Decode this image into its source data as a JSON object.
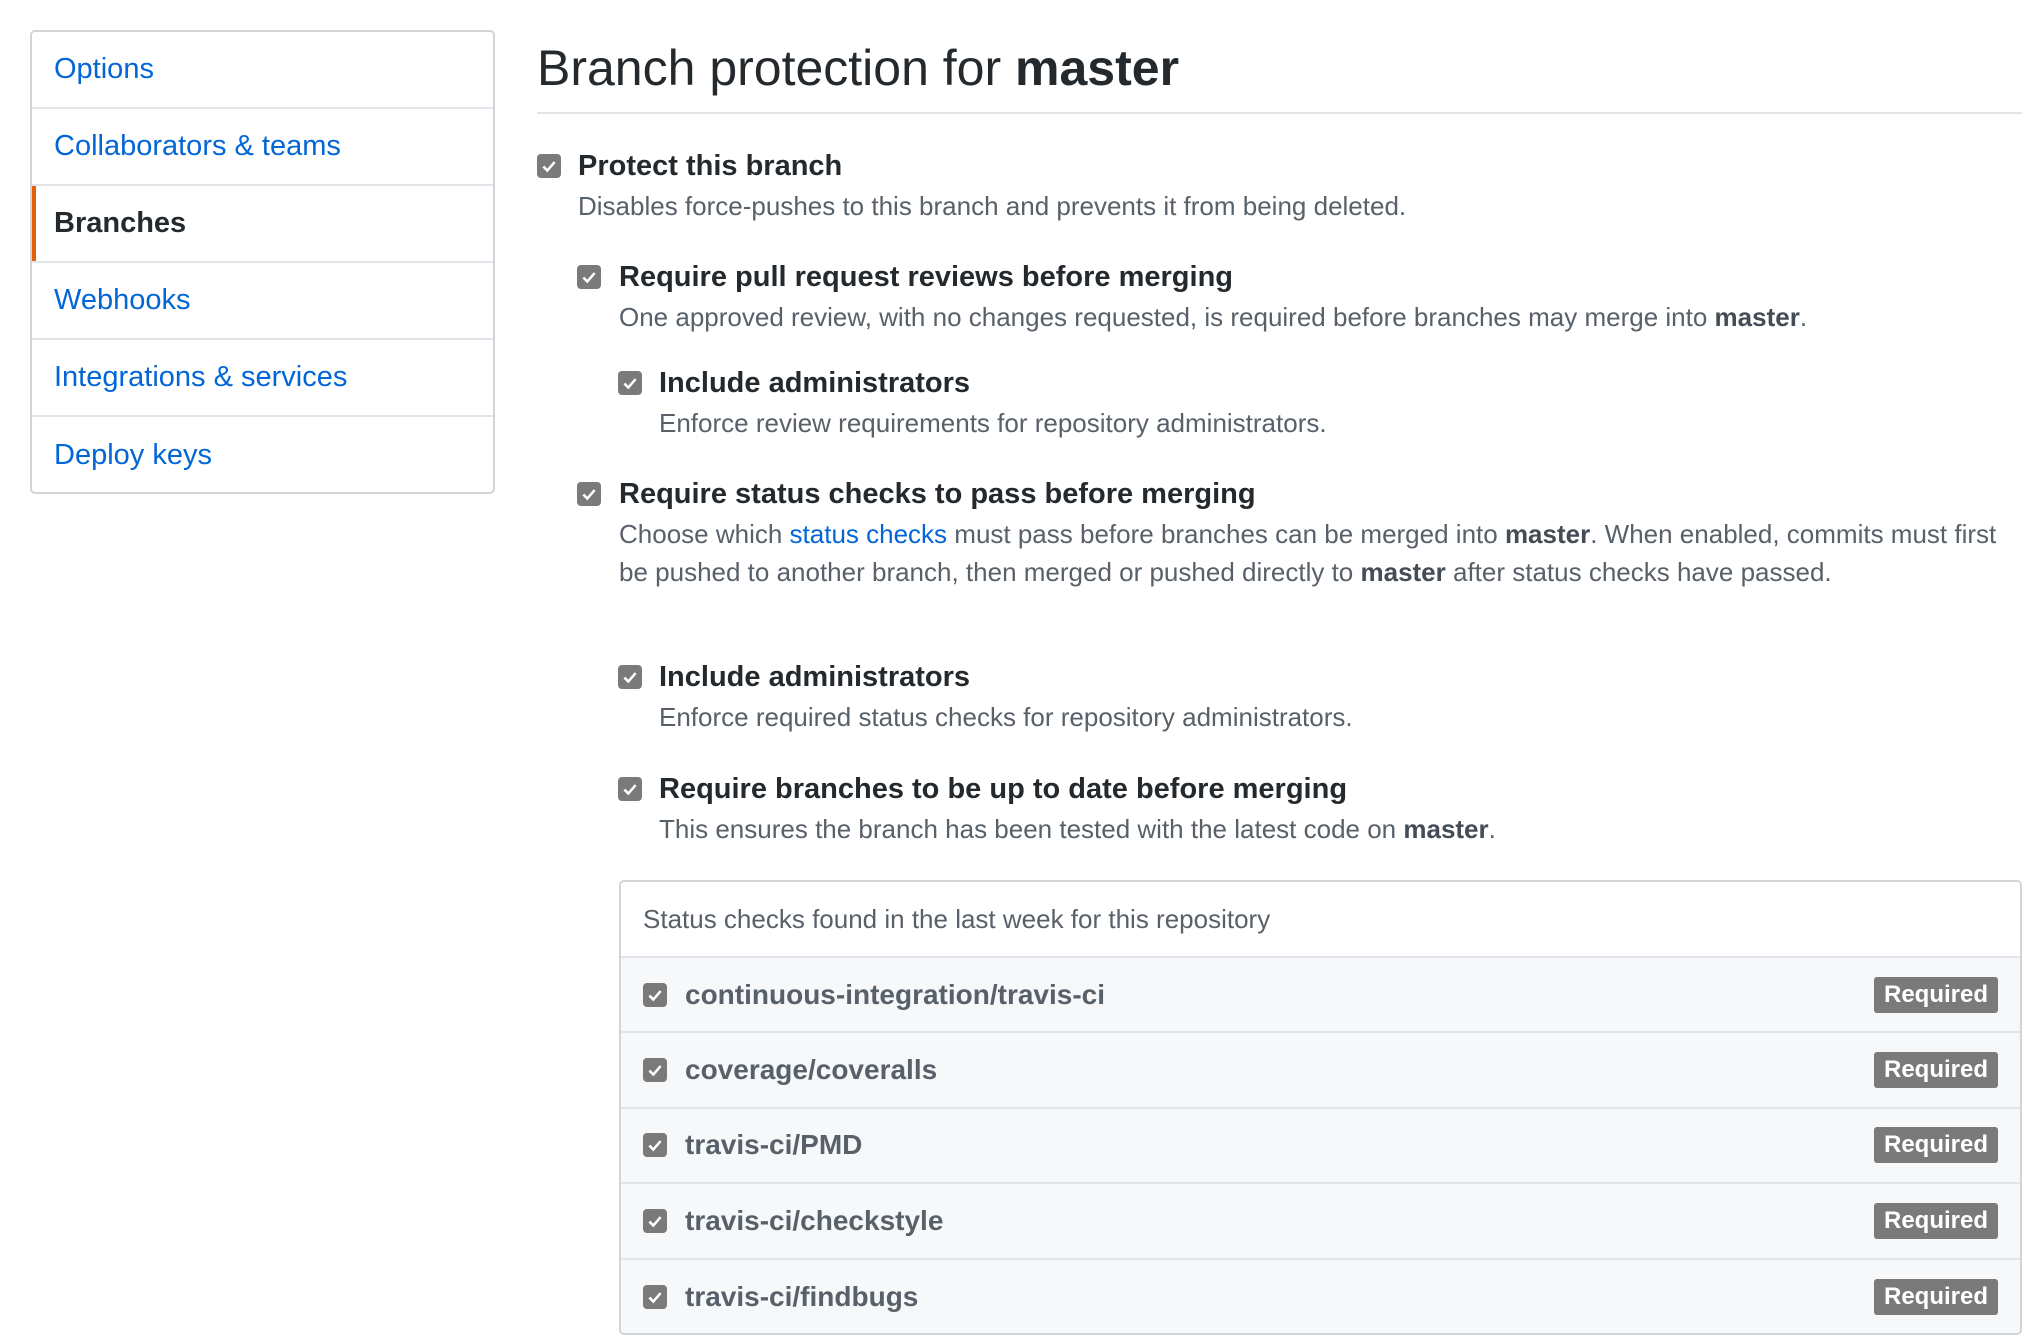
{
  "sidebar": {
    "items": [
      {
        "label": "Options",
        "active": false
      },
      {
        "label": "Collaborators & teams",
        "active": false
      },
      {
        "label": "Branches",
        "active": true
      },
      {
        "label": "Webhooks",
        "active": false
      },
      {
        "label": "Integrations & services",
        "active": false
      },
      {
        "label": "Deploy keys",
        "active": false
      }
    ]
  },
  "header": {
    "title_prefix": "Branch protection for ",
    "branch": "master"
  },
  "options": {
    "protect": {
      "checked": true,
      "label": "Protect this branch",
      "desc": "Disables force-pushes to this branch and prevents it from being deleted."
    },
    "reviews": {
      "checked": true,
      "label": "Require pull request reviews before merging",
      "desc_prefix": "One approved review, with no changes requested, is required before branches may merge into ",
      "desc_branch": "master",
      "desc_suffix": "."
    },
    "reviews_admins": {
      "checked": true,
      "label": "Include administrators",
      "desc": "Enforce review requirements for repository administrators."
    },
    "status": {
      "checked": true,
      "label": "Require status checks to pass before merging",
      "desc_1": "Choose which ",
      "desc_link": "status checks",
      "desc_2": " must pass before branches can be merged into ",
      "desc_branch_1": "master",
      "desc_3": ". When enabled, commits must first be pushed to another branch, then merged or pushed directly to ",
      "desc_branch_2": "master",
      "desc_4": " after status checks have passed."
    },
    "status_admins": {
      "checked": true,
      "label": "Include administrators",
      "desc": "Enforce required status checks for repository administrators."
    },
    "up_to_date": {
      "checked": true,
      "label": "Require branches to be up to date before merging",
      "desc_prefix": "This ensures the branch has been tested with the latest code on ",
      "desc_branch": "master",
      "desc_suffix": "."
    }
  },
  "status_checks": {
    "heading": "Status checks found in the last week for this repository",
    "rows": [
      {
        "name": "continuous-integration/travis-ci",
        "badge": "Required",
        "checked": true
      },
      {
        "name": "coverage/coveralls",
        "badge": "Required",
        "checked": true
      },
      {
        "name": "travis-ci/PMD",
        "badge": "Required",
        "checked": true
      },
      {
        "name": "travis-ci/checkstyle",
        "badge": "Required",
        "checked": true
      },
      {
        "name": "travis-ci/findbugs",
        "badge": "Required",
        "checked": true
      }
    ]
  },
  "colors": {
    "link": "#0366d6",
    "active_indicator": "#e36209",
    "checkbox_fill": "#7a7a7a",
    "badge_fill": "#7a7a7a"
  },
  "icons": {
    "checkbox": "checkmark-icon"
  }
}
